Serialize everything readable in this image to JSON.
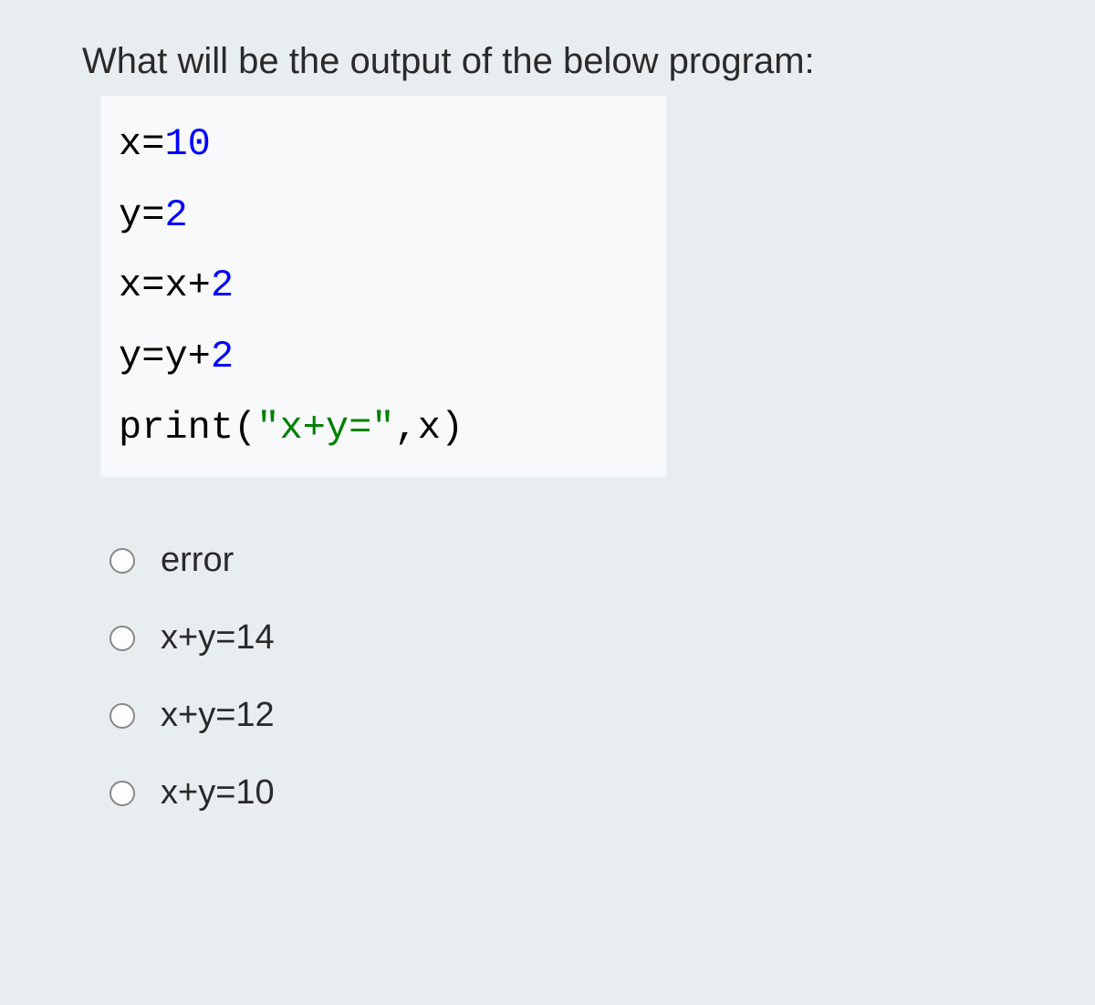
{
  "question": "What will be the output of the below program:",
  "code": {
    "line1": {
      "var": "x",
      "eq": "=",
      "val": "10"
    },
    "line2": {
      "var": "y",
      "eq": "=",
      "val": "2"
    },
    "line3": {
      "lhs": "x",
      "eq": "=",
      "rhs1": "x",
      "op": "+",
      "rhs2": "2"
    },
    "line4": {
      "lhs": "y",
      "eq": "=",
      "rhs1": "y",
      "op": "+",
      "rhs2": "2"
    },
    "line5": {
      "fn": "print",
      "open": "(",
      "str": "\"x+y=\"",
      "comma": ",",
      "arg": "x",
      "close": ")"
    }
  },
  "options": [
    {
      "label": "error"
    },
    {
      "label": "x+y=14"
    },
    {
      "label": "x+y=12"
    },
    {
      "label": "x+y=10"
    }
  ]
}
